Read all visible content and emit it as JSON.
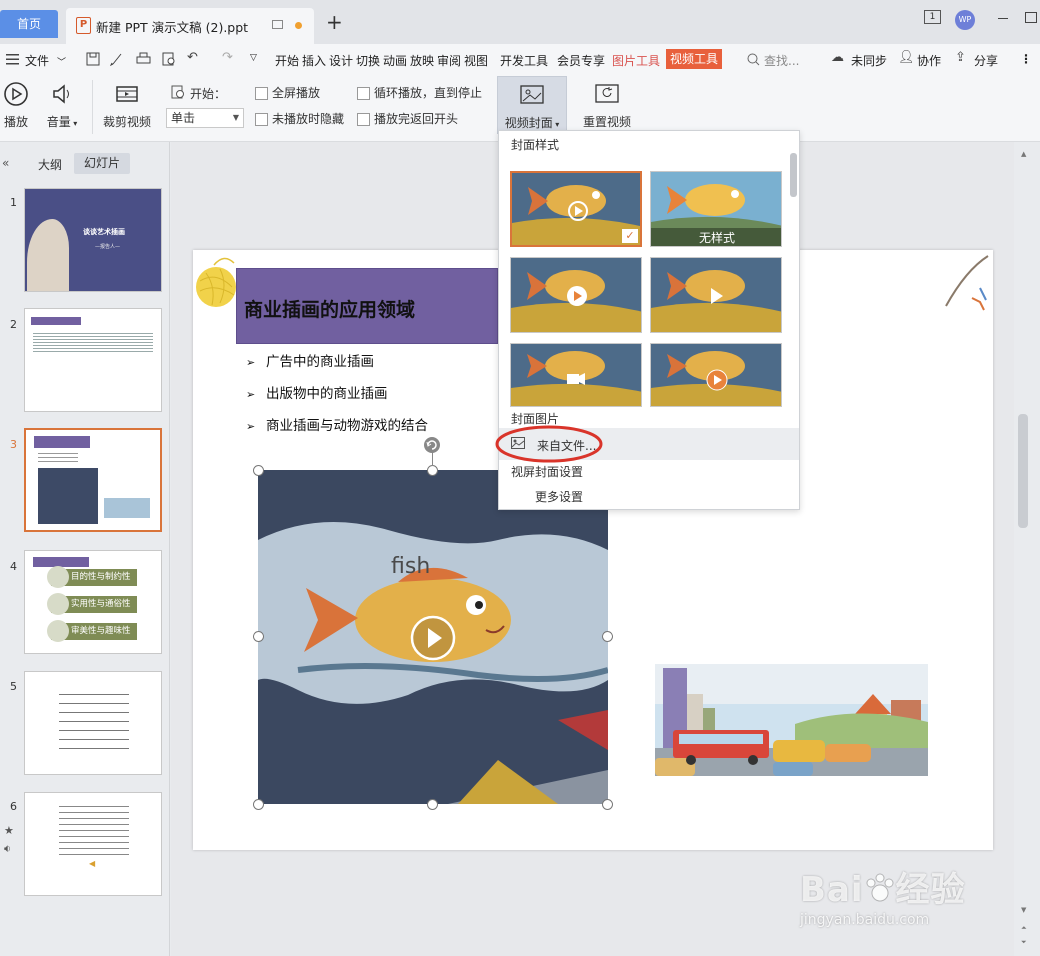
{
  "tabbar": {
    "home": "首页",
    "doc_title": "新建 PPT 演示文稿 (2).ppt",
    "plus": "+",
    "page_indicator": "1",
    "avatar": "WP"
  },
  "menu": {
    "file": "文件",
    "tabs": [
      "开始",
      "插入",
      "设计",
      "切换",
      "动画",
      "放映",
      "审阅",
      "视图",
      "开发工具",
      "会员专享"
    ],
    "picture_tools": "图片工具",
    "video_tools": "视频工具",
    "search": "查找...",
    "unsync": "未同步",
    "collab": "协作",
    "share": "分享"
  },
  "ribbon": {
    "play": "播放",
    "volume": "音量",
    "trim": "裁剪视频",
    "start_label": "开始：",
    "start_value": "单击",
    "fullscreen": "全屏播放",
    "hide_when_not_playing": "未播放时隐藏",
    "loop": "循环播放，直到停止",
    "rewind": "播放完返回开头",
    "video_cover": "视频封面",
    "reset_video": "重置视频"
  },
  "leftpanel": {
    "outline_tab": "大纲",
    "slides_tab": "幻灯片",
    "slide_numbers": [
      "1",
      "2",
      "3",
      "4",
      "5",
      "6"
    ],
    "slide1_title": "谈谈艺术插画",
    "slide1_sub": "—报告人—",
    "slide4_items": [
      "目的性与制约性",
      "实用性与通俗性",
      "审美性与趣味性"
    ]
  },
  "slide": {
    "title": "商业插画的应用领域",
    "bullets": [
      "广告中的商业插画",
      "出版物中的商业插画",
      "商业插画与动物游戏的结合"
    ],
    "video_caption": "fish"
  },
  "dropdown": {
    "cover_style": "封面样式",
    "no_style": "无样式",
    "cover_image": "封面图片",
    "from_file": "来自文件...",
    "frame_cover": "视屏封面设置",
    "more_settings": "更多设置"
  },
  "watermark": {
    "brand": "Bai",
    "brand2": "经验",
    "url": "jingyan.baidu.com"
  },
  "colors": {
    "accent_orange": "#e8603c",
    "title_bar": "#7160a0",
    "home_tab": "#5b8fe6",
    "highlight_red": "#d9342a"
  }
}
